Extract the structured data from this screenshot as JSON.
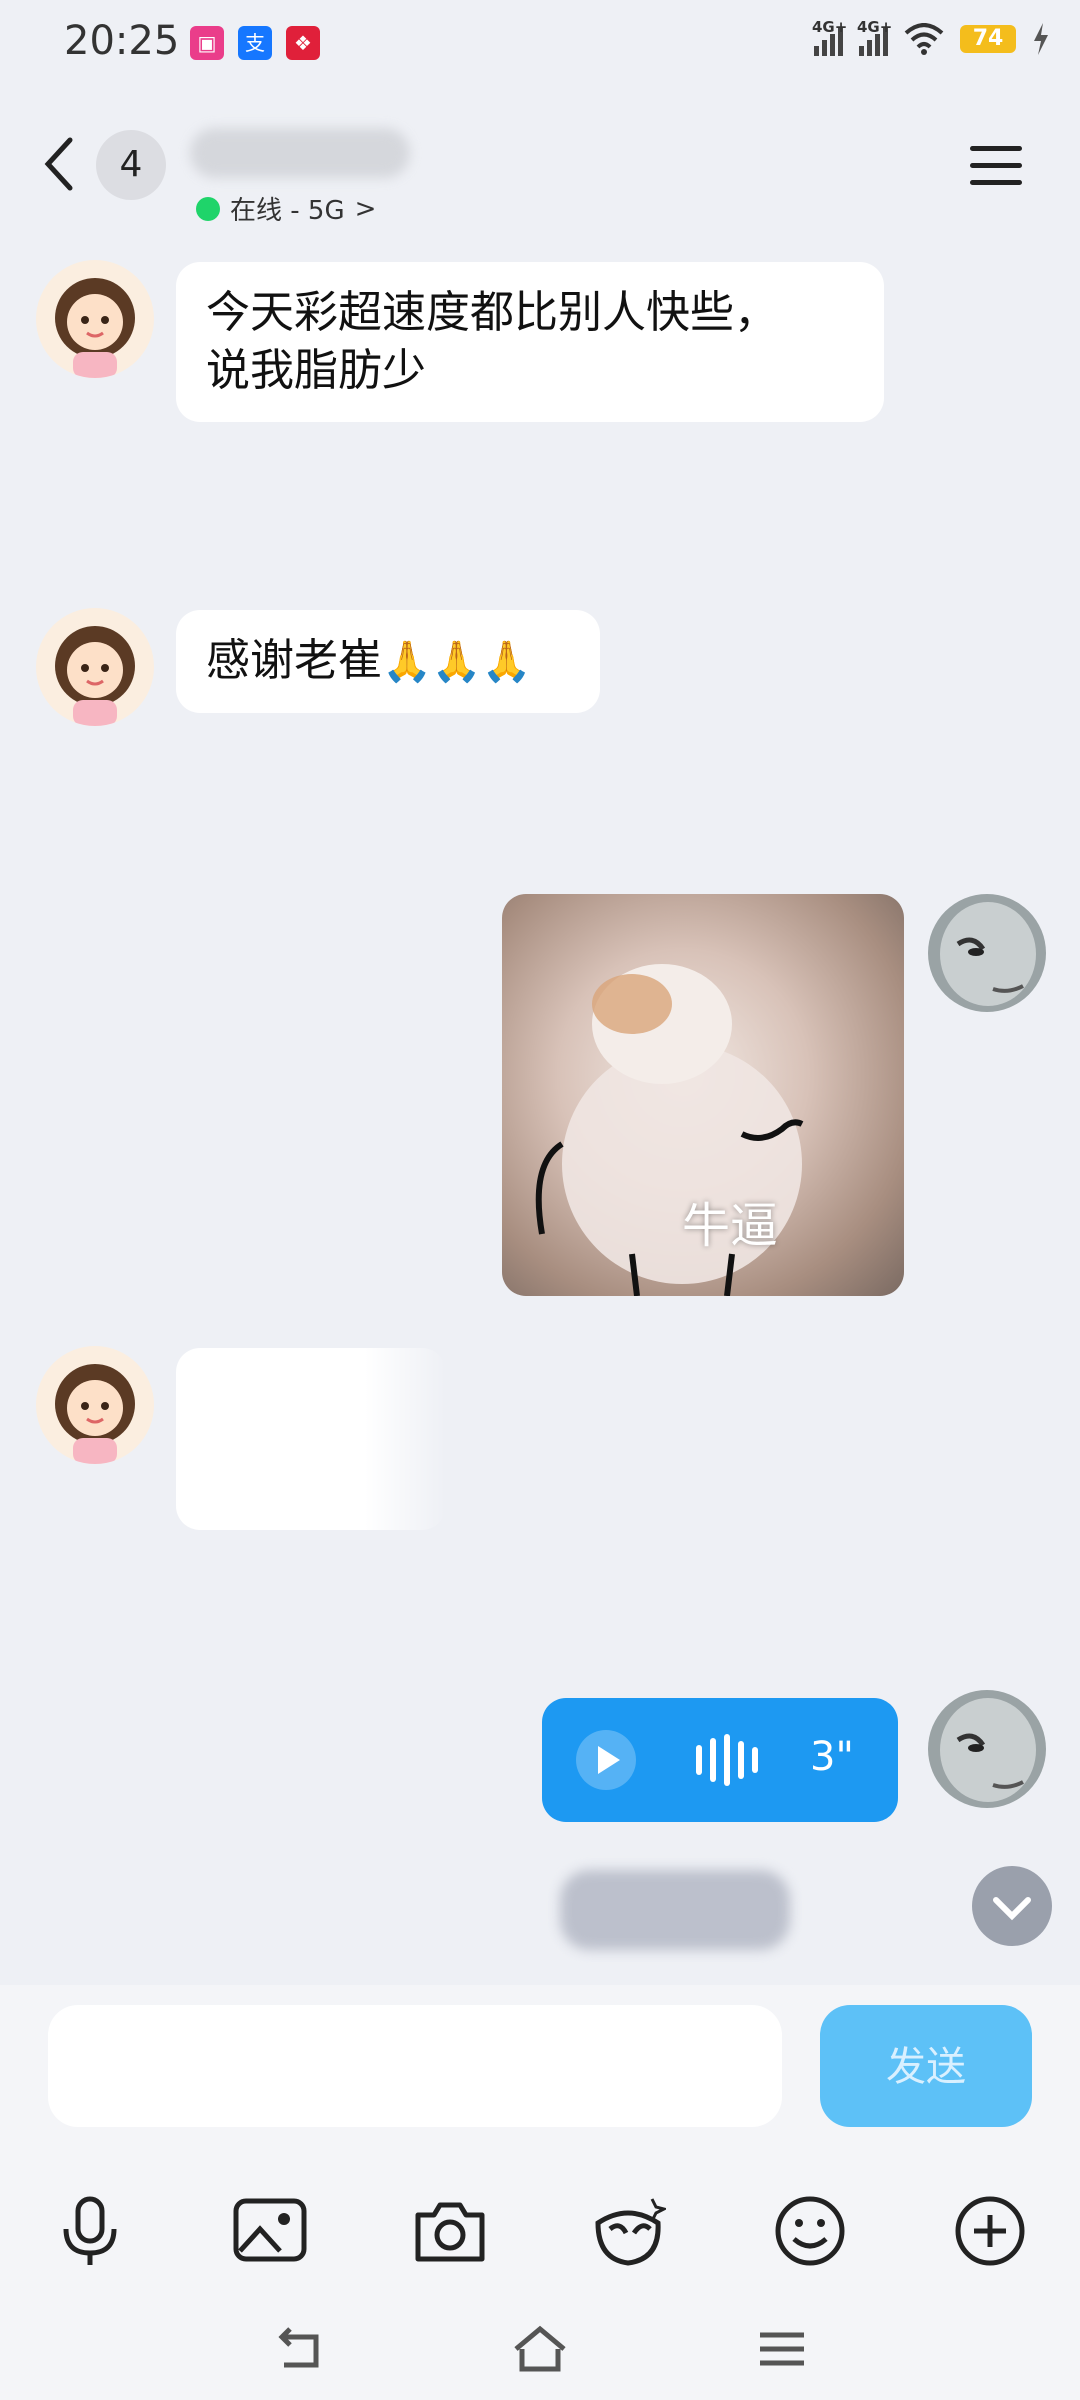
{
  "status_bar": {
    "time": "20:25",
    "network1": "4G+",
    "network2": "4G+",
    "battery": "74"
  },
  "header": {
    "unread_count": "4",
    "status": "在线 - 5G",
    "status_chevron": ">"
  },
  "messages": [
    {
      "side": "left",
      "type": "text",
      "text_line1": "今天彩超速度都比别人快些，",
      "text_line2": "说我脂肪少"
    },
    {
      "side": "left",
      "type": "text",
      "text": "感谢老崔",
      "emoji": "🙏🙏🙏"
    },
    {
      "side": "right",
      "type": "image",
      "caption": "牛逼"
    },
    {
      "side": "left",
      "type": "text",
      "text": ""
    },
    {
      "side": "right",
      "type": "voice",
      "duration": "3\""
    }
  ],
  "composer": {
    "send_label": "发送",
    "placeholder": ""
  },
  "toolbar": [
    "mic-icon",
    "image-icon",
    "camera-icon",
    "sticker-icon",
    "emoji-icon",
    "plus-icon"
  ],
  "colors": {
    "background": "#eef0f5",
    "accent": "#1d99f2",
    "send": "#5dc1f7",
    "online": "#1fd46a"
  }
}
